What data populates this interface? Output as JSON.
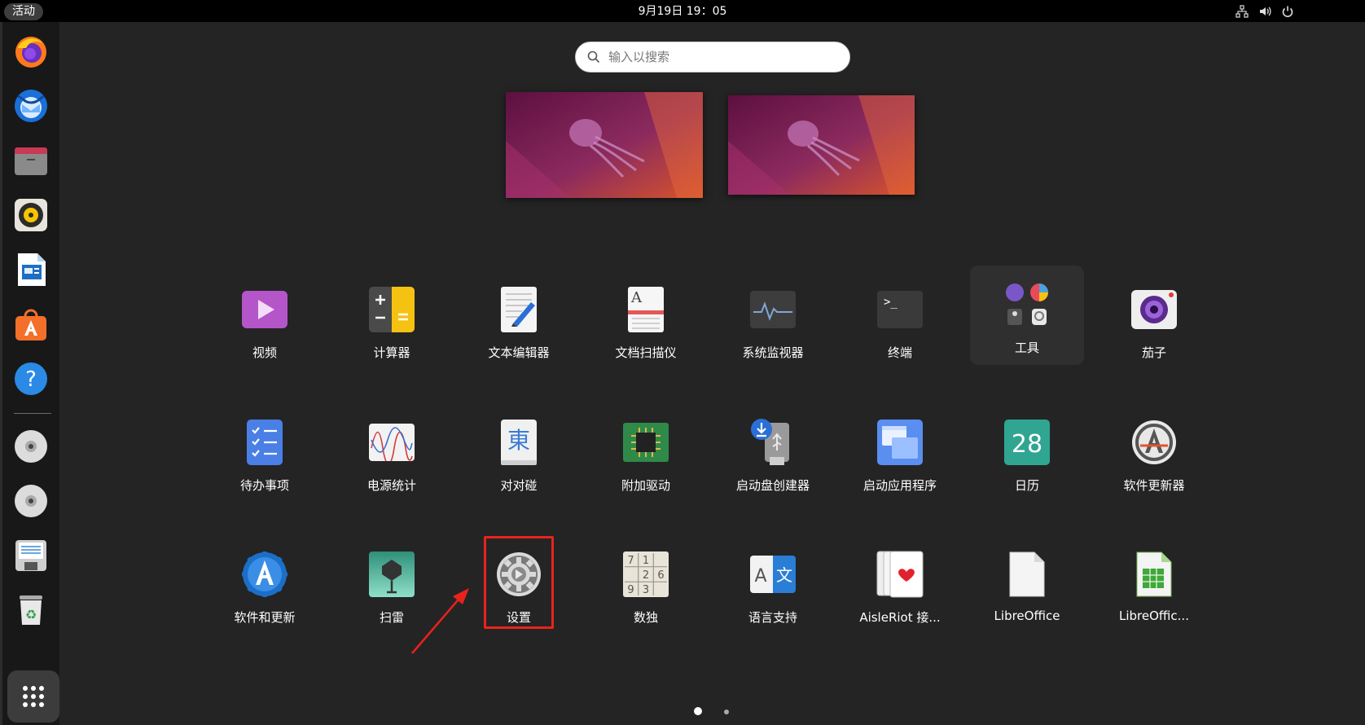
{
  "topbar": {
    "activities_label": "活动",
    "clock": "9月19日  19：05",
    "tray_icons": [
      "network-icon",
      "volume-icon",
      "power-icon"
    ]
  },
  "dock": {
    "apps": [
      "firefox",
      "thunderbird",
      "files",
      "rhythmbox",
      "libreoffice-writer",
      "software-center",
      "help",
      "dvd-drive-1",
      "dvd-drive-2",
      "floppy-drive",
      "trash"
    ]
  },
  "search": {
    "placeholder": "输入以搜索"
  },
  "apps": [
    {
      "label": "视频"
    },
    {
      "label": "计算器"
    },
    {
      "label": "文本编辑器"
    },
    {
      "label": "文档扫描仪"
    },
    {
      "label": "系统监视器"
    },
    {
      "label": "终端"
    },
    {
      "label": "工具"
    },
    {
      "label": "茄子"
    },
    {
      "label": "待办事项"
    },
    {
      "label": "电源统计"
    },
    {
      "label": "对对碰"
    },
    {
      "label": "附加驱动"
    },
    {
      "label": "启动盘创建器"
    },
    {
      "label": "启动应用程序"
    },
    {
      "label": "日历"
    },
    {
      "label": "软件更新器"
    },
    {
      "label": "软件和更新"
    },
    {
      "label": "扫雷"
    },
    {
      "label": "设置"
    },
    {
      "label": "数独"
    },
    {
      "label": "语言支持"
    },
    {
      "label": "AisleRiot 接..."
    },
    {
      "label": "LibreOffice"
    },
    {
      "label": "LibreOffic..."
    }
  ],
  "icon_text": {
    "terminal_prompt": ">_",
    "mahjongg_char": "東",
    "calendar_day": "28",
    "lang_a": "A",
    "lang_wen": "文",
    "sudoku": [
      "7",
      "1",
      "",
      "",
      "2",
      "6",
      "9",
      "3",
      ""
    ]
  },
  "pagination": {
    "pages": 2,
    "current": 1
  },
  "annotation": {
    "highlighted_app": "设置"
  },
  "colors": {
    "background": "#242424",
    "topbar": "#000000",
    "dock": "#181818",
    "highlight": "#e8231c"
  }
}
